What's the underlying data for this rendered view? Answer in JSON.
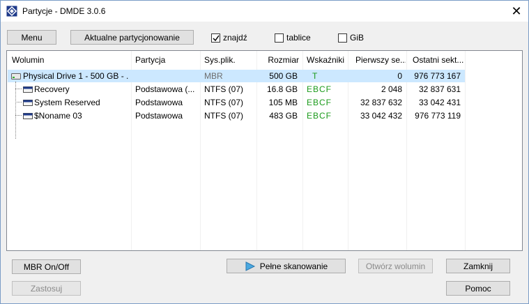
{
  "window": {
    "title": "Partycje - DMDE 3.0.6",
    "close_glyph": "✕"
  },
  "toolbar": {
    "menu_label": "Menu",
    "current_partitioning_label": "Aktualne partycjonowanie",
    "checkboxes": [
      {
        "label": "znajdź",
        "checked": true
      },
      {
        "label": "tablice",
        "checked": false
      },
      {
        "label": "GiB",
        "checked": false
      }
    ]
  },
  "table": {
    "headers": [
      "Wolumin",
      "Partycja",
      "Sys.plik.",
      "Rozmiar",
      "Wskaźniki",
      "Pierwszy se...",
      "Ostatni sekt..."
    ],
    "rows": [
      {
        "volume": "Physical Drive 1 - 500 GB - ...",
        "partition": "",
        "fs": "MBR",
        "size": "500 GB",
        "flags": "T",
        "first": "0",
        "last": "976 773 167",
        "selected": true
      },
      {
        "volume": "Recovery",
        "partition": "Podstawowa (...",
        "fs": "NTFS (07)",
        "size": "16.8 GB",
        "flags": "EBCF",
        "first": "2 048",
        "last": "32 837 631"
      },
      {
        "volume": "System Reserved",
        "partition": "Podstawowa",
        "fs": "NTFS (07)",
        "size": "105 MB",
        "flags": "EBCF",
        "first": "32 837 632",
        "last": "33 042 431"
      },
      {
        "volume": "$Noname 03",
        "partition": "Podstawowa",
        "fs": "NTFS (07)",
        "size": "483 GB",
        "flags": "EBCF",
        "first": "33 042 432",
        "last": "976 773 119"
      }
    ]
  },
  "buttons": {
    "mbr_onoff": "MBR On/Off",
    "apply": "Zastosuj",
    "full_scan": "Pełne skanowanie",
    "open_volume": "Otwórz wolumin",
    "close": "Zamknij",
    "help": "Pomoc"
  },
  "colors": {
    "selection": "#cce8ff",
    "flags_green": "#1a9a1a",
    "scan_icon": "#4aa8e0"
  }
}
